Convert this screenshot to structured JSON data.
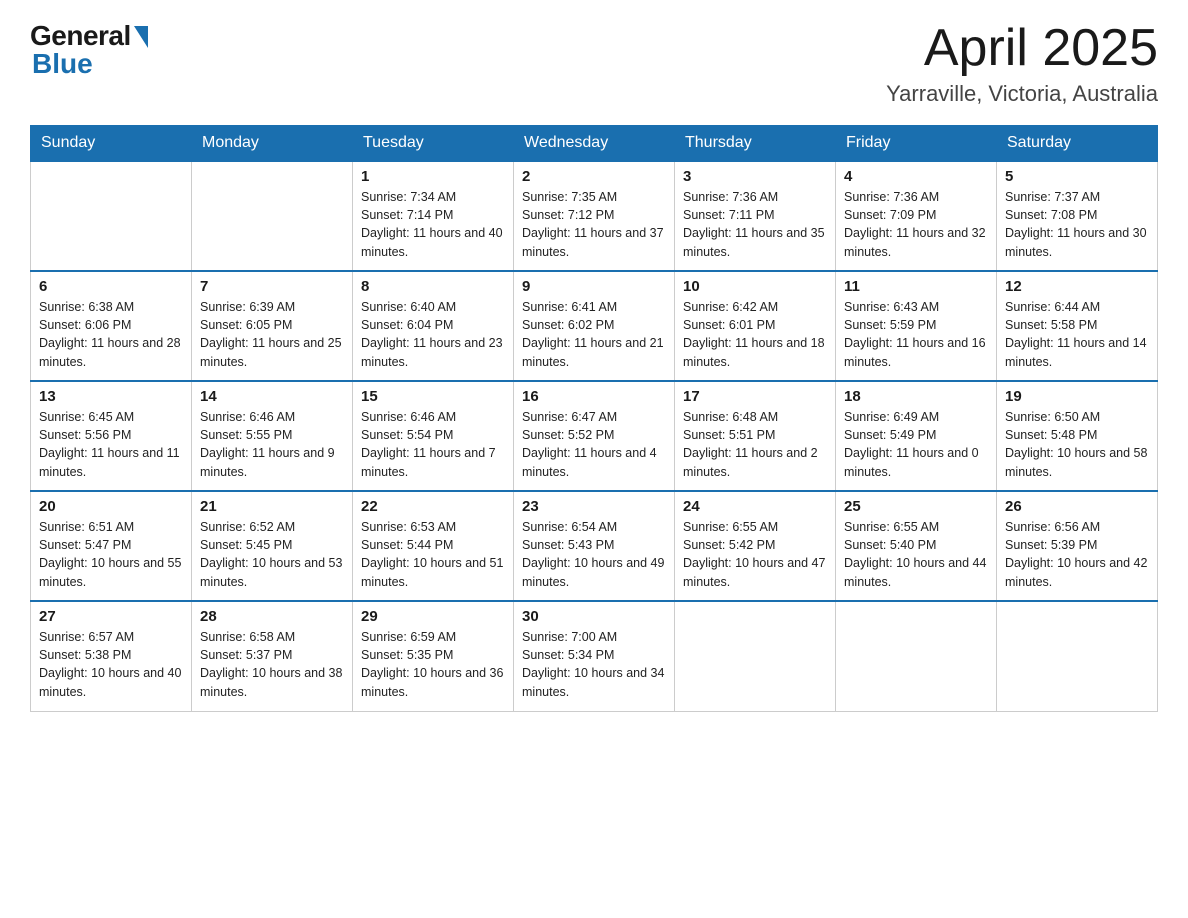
{
  "header": {
    "logo": {
      "text_general": "General",
      "text_blue": "Blue"
    },
    "month_title": "April 2025",
    "location": "Yarraville, Victoria, Australia"
  },
  "weekdays": [
    "Sunday",
    "Monday",
    "Tuesday",
    "Wednesday",
    "Thursday",
    "Friday",
    "Saturday"
  ],
  "weeks": [
    [
      {
        "day": "",
        "sunrise": "",
        "sunset": "",
        "daylight": ""
      },
      {
        "day": "",
        "sunrise": "",
        "sunset": "",
        "daylight": ""
      },
      {
        "day": "1",
        "sunrise": "Sunrise: 7:34 AM",
        "sunset": "Sunset: 7:14 PM",
        "daylight": "Daylight: 11 hours and 40 minutes."
      },
      {
        "day": "2",
        "sunrise": "Sunrise: 7:35 AM",
        "sunset": "Sunset: 7:12 PM",
        "daylight": "Daylight: 11 hours and 37 minutes."
      },
      {
        "day": "3",
        "sunrise": "Sunrise: 7:36 AM",
        "sunset": "Sunset: 7:11 PM",
        "daylight": "Daylight: 11 hours and 35 minutes."
      },
      {
        "day": "4",
        "sunrise": "Sunrise: 7:36 AM",
        "sunset": "Sunset: 7:09 PM",
        "daylight": "Daylight: 11 hours and 32 minutes."
      },
      {
        "day": "5",
        "sunrise": "Sunrise: 7:37 AM",
        "sunset": "Sunset: 7:08 PM",
        "daylight": "Daylight: 11 hours and 30 minutes."
      }
    ],
    [
      {
        "day": "6",
        "sunrise": "Sunrise: 6:38 AM",
        "sunset": "Sunset: 6:06 PM",
        "daylight": "Daylight: 11 hours and 28 minutes."
      },
      {
        "day": "7",
        "sunrise": "Sunrise: 6:39 AM",
        "sunset": "Sunset: 6:05 PM",
        "daylight": "Daylight: 11 hours and 25 minutes."
      },
      {
        "day": "8",
        "sunrise": "Sunrise: 6:40 AM",
        "sunset": "Sunset: 6:04 PM",
        "daylight": "Daylight: 11 hours and 23 minutes."
      },
      {
        "day": "9",
        "sunrise": "Sunrise: 6:41 AM",
        "sunset": "Sunset: 6:02 PM",
        "daylight": "Daylight: 11 hours and 21 minutes."
      },
      {
        "day": "10",
        "sunrise": "Sunrise: 6:42 AM",
        "sunset": "Sunset: 6:01 PM",
        "daylight": "Daylight: 11 hours and 18 minutes."
      },
      {
        "day": "11",
        "sunrise": "Sunrise: 6:43 AM",
        "sunset": "Sunset: 5:59 PM",
        "daylight": "Daylight: 11 hours and 16 minutes."
      },
      {
        "day": "12",
        "sunrise": "Sunrise: 6:44 AM",
        "sunset": "Sunset: 5:58 PM",
        "daylight": "Daylight: 11 hours and 14 minutes."
      }
    ],
    [
      {
        "day": "13",
        "sunrise": "Sunrise: 6:45 AM",
        "sunset": "Sunset: 5:56 PM",
        "daylight": "Daylight: 11 hours and 11 minutes."
      },
      {
        "day": "14",
        "sunrise": "Sunrise: 6:46 AM",
        "sunset": "Sunset: 5:55 PM",
        "daylight": "Daylight: 11 hours and 9 minutes."
      },
      {
        "day": "15",
        "sunrise": "Sunrise: 6:46 AM",
        "sunset": "Sunset: 5:54 PM",
        "daylight": "Daylight: 11 hours and 7 minutes."
      },
      {
        "day": "16",
        "sunrise": "Sunrise: 6:47 AM",
        "sunset": "Sunset: 5:52 PM",
        "daylight": "Daylight: 11 hours and 4 minutes."
      },
      {
        "day": "17",
        "sunrise": "Sunrise: 6:48 AM",
        "sunset": "Sunset: 5:51 PM",
        "daylight": "Daylight: 11 hours and 2 minutes."
      },
      {
        "day": "18",
        "sunrise": "Sunrise: 6:49 AM",
        "sunset": "Sunset: 5:49 PM",
        "daylight": "Daylight: 11 hours and 0 minutes."
      },
      {
        "day": "19",
        "sunrise": "Sunrise: 6:50 AM",
        "sunset": "Sunset: 5:48 PM",
        "daylight": "Daylight: 10 hours and 58 minutes."
      }
    ],
    [
      {
        "day": "20",
        "sunrise": "Sunrise: 6:51 AM",
        "sunset": "Sunset: 5:47 PM",
        "daylight": "Daylight: 10 hours and 55 minutes."
      },
      {
        "day": "21",
        "sunrise": "Sunrise: 6:52 AM",
        "sunset": "Sunset: 5:45 PM",
        "daylight": "Daylight: 10 hours and 53 minutes."
      },
      {
        "day": "22",
        "sunrise": "Sunrise: 6:53 AM",
        "sunset": "Sunset: 5:44 PM",
        "daylight": "Daylight: 10 hours and 51 minutes."
      },
      {
        "day": "23",
        "sunrise": "Sunrise: 6:54 AM",
        "sunset": "Sunset: 5:43 PM",
        "daylight": "Daylight: 10 hours and 49 minutes."
      },
      {
        "day": "24",
        "sunrise": "Sunrise: 6:55 AM",
        "sunset": "Sunset: 5:42 PM",
        "daylight": "Daylight: 10 hours and 47 minutes."
      },
      {
        "day": "25",
        "sunrise": "Sunrise: 6:55 AM",
        "sunset": "Sunset: 5:40 PM",
        "daylight": "Daylight: 10 hours and 44 minutes."
      },
      {
        "day": "26",
        "sunrise": "Sunrise: 6:56 AM",
        "sunset": "Sunset: 5:39 PM",
        "daylight": "Daylight: 10 hours and 42 minutes."
      }
    ],
    [
      {
        "day": "27",
        "sunrise": "Sunrise: 6:57 AM",
        "sunset": "Sunset: 5:38 PM",
        "daylight": "Daylight: 10 hours and 40 minutes."
      },
      {
        "day": "28",
        "sunrise": "Sunrise: 6:58 AM",
        "sunset": "Sunset: 5:37 PM",
        "daylight": "Daylight: 10 hours and 38 minutes."
      },
      {
        "day": "29",
        "sunrise": "Sunrise: 6:59 AM",
        "sunset": "Sunset: 5:35 PM",
        "daylight": "Daylight: 10 hours and 36 minutes."
      },
      {
        "day": "30",
        "sunrise": "Sunrise: 7:00 AM",
        "sunset": "Sunset: 5:34 PM",
        "daylight": "Daylight: 10 hours and 34 minutes."
      },
      {
        "day": "",
        "sunrise": "",
        "sunset": "",
        "daylight": ""
      },
      {
        "day": "",
        "sunrise": "",
        "sunset": "",
        "daylight": ""
      },
      {
        "day": "",
        "sunrise": "",
        "sunset": "",
        "daylight": ""
      }
    ]
  ]
}
